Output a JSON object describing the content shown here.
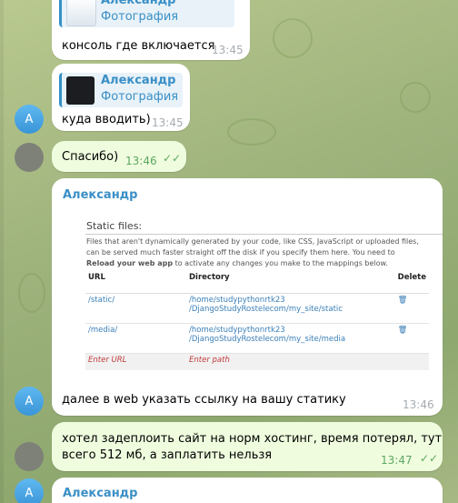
{
  "messages": [
    {
      "reply": {
        "name": "Александр",
        "kind": "Фотография"
      },
      "text": "консоль где включается",
      "time": "13:45"
    },
    {
      "reply": {
        "name": "Александр",
        "kind": "Фотография"
      },
      "text": "куда вводить)",
      "time": "13:45",
      "avatar": "А"
    },
    {
      "text": "Спасибо)",
      "time": "13:46",
      "status": "read"
    },
    {
      "sender": "Александр",
      "text": "далее в web  указать ссылку на вашу статику",
      "time": "13:46",
      "avatar": "А",
      "screenshot": {
        "title": "Static files:",
        "desc_line1": "Files that aren't dynamically generated by your code, like CSS, JavaScript or uploaded files,",
        "desc_line2": "can be served much faster straight off the disk if you specify them here. You need to",
        "desc_bold": "Reload your web app",
        "desc_line3_rest": " to activate any changes you make to the mappings below.",
        "headers": [
          "URL",
          "Directory",
          "Delete"
        ],
        "rows": [
          {
            "url": "/static/",
            "dir1": "/home/studypythonrtk23",
            "dir2": "/DjangoStudyRostelecom/my_site/static"
          },
          {
            "url": "/media/",
            "dir1": "/home/studypythonrtk23",
            "dir2": "/DjangoStudyRostelecom/my_site/media"
          }
        ],
        "placeholder_url": "Enter URL",
        "placeholder_path": "Enter path"
      }
    },
    {
      "text_line1": "хотел задеплоить сайт на норм хостинг, время потерял, тут",
      "text_line2": "всего 512 мб, а заплатить нельзя",
      "time": "13:47",
      "status": "read"
    },
    {
      "sender": "Александр",
      "avatar": "А"
    }
  ],
  "icons": {
    "read": "double-check-icon",
    "delete": "trash-icon"
  },
  "colors": {
    "accent": "#3a8fc6",
    "outgoing_bubble": "#effdde",
    "incoming_bubble": "#ffffff",
    "read_check": "#5ea764"
  }
}
